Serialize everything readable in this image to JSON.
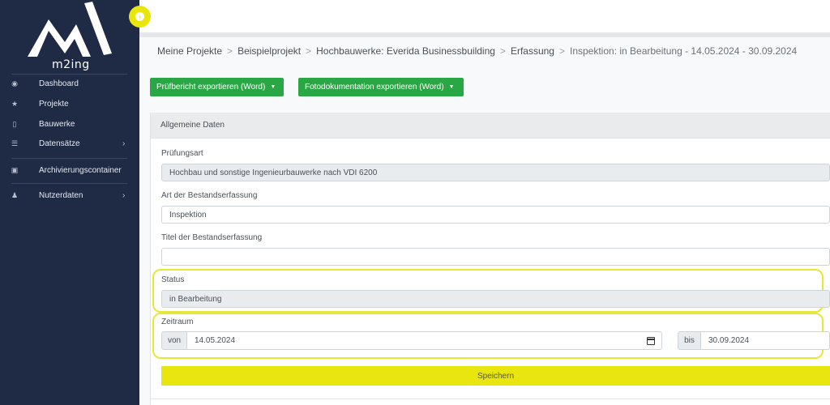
{
  "brand": {
    "logo_text": "m2ing"
  },
  "sidebar": {
    "items": [
      {
        "label": "Dashboard",
        "icon": "dashboard-icon",
        "glyph": "◉",
        "has_children": false
      },
      {
        "label": "Projekte",
        "icon": "star-icon",
        "glyph": "★",
        "has_children": false
      },
      {
        "label": "Bauwerke",
        "icon": "building-icon",
        "glyph": "▯",
        "has_children": false
      },
      {
        "label": "Datensätze",
        "icon": "list-icon",
        "glyph": "☰",
        "has_children": true
      },
      {
        "label": "Archivierungscontainer",
        "icon": "archive-icon",
        "glyph": "▣",
        "has_children": false
      },
      {
        "label": "Nutzerdaten",
        "icon": "user-icon",
        "glyph": "♟",
        "has_children": true
      }
    ],
    "chevron": "›"
  },
  "breadcrumb": {
    "items": [
      "Meine Projekte",
      "Beispielprojekt",
      "Hochbauwerke: Everida Businessbuilding",
      "Erfassung",
      "Inspektion: in Bearbeitung - 14.05.2024 - 30.09.2024"
    ],
    "separator": ">"
  },
  "toolbar": {
    "export_report_label": "Prüfbericht exportieren (Word)",
    "export_photos_label": "Fotodokumentation exportieren (Word)",
    "caret": "▼"
  },
  "card": {
    "header": "Allgemeine Daten"
  },
  "form": {
    "pruefungsart_label": "Prüfungsart",
    "pruefungsart_value": "Hochbau und sonstige Ingenieurbauwerke nach VDI 6200",
    "art_label": "Art der Bestandserfassung",
    "art_value": "Inspektion",
    "titel_label": "Titel der Bestandserfassung",
    "titel_value": "",
    "status_label": "Status",
    "status_value": "in Bearbeitung",
    "zeitraum_label": "Zeitraum",
    "von_label": "von",
    "von_value": "14.05.2024",
    "bis_label": "bis",
    "bis_value": "30.09.2024",
    "save_label": "Speichern"
  },
  "colors": {
    "sidebar": "#1f2a44",
    "accent_yellow": "#e9e60f",
    "button_green": "#2aa745"
  }
}
